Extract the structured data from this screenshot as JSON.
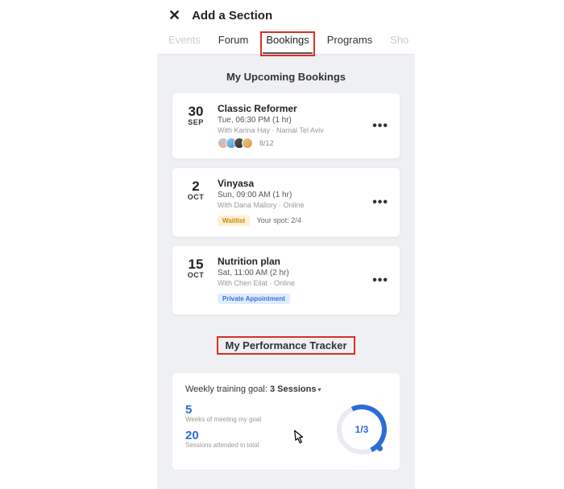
{
  "header": {
    "title": "Add a Section"
  },
  "tabs": {
    "events": "Events",
    "forum": "Forum",
    "bookings": "Bookings",
    "programs": "Programs",
    "shop": "Sho"
  },
  "upcoming": {
    "title": "My Upcoming Bookings",
    "items": [
      {
        "day": "30",
        "month": "SEP",
        "name": "Classic Reformer",
        "time": "Tue, 06:30 PM (1 hr)",
        "meta": "With Karina Hay · Namal Tel Aviv",
        "count": "8/12"
      },
      {
        "day": "2",
        "month": "OCT",
        "name": "Vinyasa",
        "time": "Sun, 09:00 AM (1 hr)",
        "meta": "With Dana Mallory · Online",
        "waitlist": "Waitlist",
        "spot": "Your spot: 2/4"
      },
      {
        "day": "15",
        "month": "OCT",
        "name": "Nutrition plan",
        "time": "Sat, 11:00 AM (2 hr)",
        "meta": "With Chen Eilat · Online",
        "private": "Private Appointment"
      }
    ]
  },
  "tracker": {
    "title": "My Performance Tracker",
    "goal_prefix": "Weekly training goal: ",
    "goal_value": "3 Sessions",
    "weeks_num": "5",
    "weeks_label": "Weeks of meeting my goal",
    "sessions_num": "20",
    "sessions_label": "Sessions attended in total",
    "progress": "1/3"
  }
}
